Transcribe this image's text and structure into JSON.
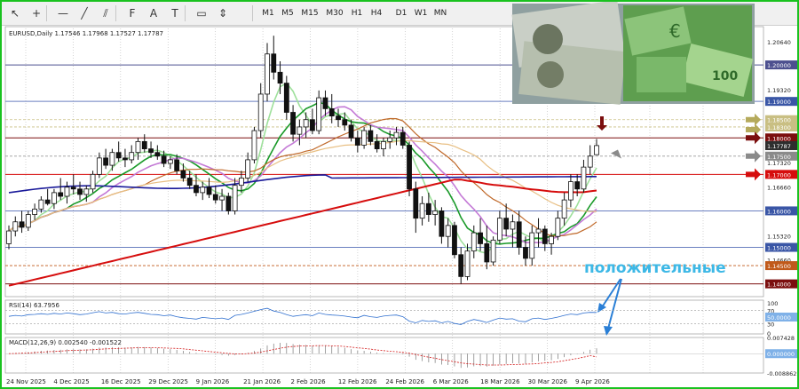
{
  "toolbar": {
    "tools": [
      {
        "name": "cursor-icon",
        "glyph": "↖"
      },
      {
        "name": "crosshair-icon",
        "glyph": "+"
      },
      {
        "name": "hline-icon",
        "glyph": "—"
      },
      {
        "name": "trendline-icon",
        "glyph": "╱"
      },
      {
        "name": "channel-icon",
        "glyph": "⫽"
      },
      {
        "name": "fibo-icon",
        "glyph": "F"
      },
      {
        "name": "text-icon",
        "glyph": "A"
      },
      {
        "name": "label-icon",
        "glyph": "T"
      },
      {
        "name": "shape-icon",
        "glyph": "▭"
      },
      {
        "name": "arrows-icon",
        "glyph": "⇕"
      }
    ],
    "timeframes": [
      "M1",
      "M5",
      "M15",
      "M30",
      "H1",
      "H4",
      "D1",
      "W1",
      "MN"
    ]
  },
  "chart_data": {
    "type": "candlestick",
    "header": "EURUSD,Daily  1.17546 1.17968 1.17527 1.17787",
    "annotation": "положительные",
    "ylim": [
      1.1365,
      1.21
    ],
    "price_ticks": [
      {
        "v": 1.2064,
        "t": "1.20640"
      },
      {
        "v": 1.1932,
        "t": "1.19320"
      },
      {
        "v": 1.1798,
        "t": "1.17980"
      },
      {
        "v": 1.1732,
        "t": "1.17320"
      },
      {
        "v": 1.1666,
        "t": "1.16660"
      },
      {
        "v": 1.1532,
        "t": "1.15320"
      },
      {
        "v": 1.1466,
        "t": "1.14660"
      }
    ],
    "price_tags": [
      {
        "v": 1.2,
        "t": "1.20000",
        "bg": "#4c4f8f"
      },
      {
        "v": 1.19,
        "t": "1.19000",
        "bg": "#3a56a6"
      },
      {
        "v": 1.185,
        "t": "1.18500",
        "bg": "#c9bf83"
      },
      {
        "v": 1.183,
        "t": "1.18300",
        "bg": "#c9bf83"
      },
      {
        "v": 1.18,
        "t": "1.18000",
        "bg": "#7b0e0e"
      },
      {
        "v": 1.17787,
        "t": "1.17787",
        "bg": "#2e2e2e"
      },
      {
        "v": 1.175,
        "t": "1.17500",
        "bg": "#8a8a8a"
      },
      {
        "v": 1.17,
        "t": "1.17000",
        "bg": "#d60d0d"
      },
      {
        "v": 1.16,
        "t": "1.16000",
        "bg": "#3a56a6"
      },
      {
        "v": 1.15,
        "t": "1.15000",
        "bg": "#3a56a6"
      },
      {
        "v": 1.145,
        "t": "1.14500",
        "bg": "#c0591a"
      },
      {
        "v": 1.14,
        "t": "1.14000",
        "bg": "#7b0e0e"
      }
    ],
    "levels": [
      {
        "v": 1.2,
        "color": "#4c4f8f",
        "dash": false
      },
      {
        "v": 1.19,
        "color": "#6a7fc0",
        "dash": false
      },
      {
        "v": 1.185,
        "color": "#c9bf83",
        "dash": true
      },
      {
        "v": 1.183,
        "color": "#c9bf83",
        "dash": true
      },
      {
        "v": 1.18,
        "color": "#7b0e0e",
        "dash": false
      },
      {
        "v": 1.175,
        "color": "#9a9a9a",
        "dash": true
      },
      {
        "v": 1.17,
        "color": "#d60d0d",
        "dash": false
      },
      {
        "v": 1.16,
        "color": "#6a7fc0",
        "dash": false
      },
      {
        "v": 1.15,
        "color": "#6a7fc0",
        "dash": false
      },
      {
        "v": 1.145,
        "color": "#c0591a",
        "dash": true
      },
      {
        "v": 1.14,
        "color": "#7b0e0e",
        "dash": false
      }
    ],
    "date_labels": [
      "24 Nov 2025",
      "4 Dec 2025",
      "16 Dec 2025",
      "29 Dec 2025",
      "9 Jan 2026",
      "21 Jan 2026",
      "2 Feb 2026",
      "12 Feb 2026",
      "24 Feb 2026",
      "6 Mar 2026",
      "18 Mar 2026",
      "30 Mar 2026",
      "9 Apr 2026"
    ],
    "candles": [
      [
        1.151,
        1.156,
        1.1495,
        1.1545
      ],
      [
        1.1545,
        1.1585,
        1.153,
        1.157
      ],
      [
        1.157,
        1.16,
        1.154,
        1.1555
      ],
      [
        1.1555,
        1.16,
        1.1545,
        1.159
      ],
      [
        1.159,
        1.162,
        1.1575,
        1.1605
      ],
      [
        1.1605,
        1.164,
        1.1595,
        1.163
      ],
      [
        1.163,
        1.166,
        1.1615,
        1.162
      ],
      [
        1.162,
        1.166,
        1.1605,
        1.165
      ],
      [
        1.165,
        1.169,
        1.163,
        1.164
      ],
      [
        1.164,
        1.168,
        1.162,
        1.1665
      ],
      [
        1.1665,
        1.17,
        1.1645,
        1.166
      ],
      [
        1.166,
        1.168,
        1.163,
        1.1645
      ],
      [
        1.1645,
        1.167,
        1.1625,
        1.166
      ],
      [
        1.166,
        1.171,
        1.165,
        1.17
      ],
      [
        1.17,
        1.176,
        1.169,
        1.1745
      ],
      [
        1.1745,
        1.177,
        1.1715,
        1.1725
      ],
      [
        1.1725,
        1.177,
        1.171,
        1.176
      ],
      [
        1.176,
        1.179,
        1.1735,
        1.1745
      ],
      [
        1.1745,
        1.177,
        1.172,
        1.174
      ],
      [
        1.174,
        1.178,
        1.173,
        1.176
      ],
      [
        1.176,
        1.18,
        1.174,
        1.179
      ],
      [
        1.179,
        1.181,
        1.176,
        1.177
      ],
      [
        1.177,
        1.179,
        1.1745,
        1.176
      ],
      [
        1.176,
        1.178,
        1.174,
        1.175
      ],
      [
        1.175,
        1.1765,
        1.172,
        1.173
      ],
      [
        1.173,
        1.175,
        1.1715,
        1.174
      ],
      [
        1.174,
        1.1755,
        1.17,
        1.171
      ],
      [
        1.171,
        1.173,
        1.168,
        1.169
      ],
      [
        1.169,
        1.171,
        1.166,
        1.167
      ],
      [
        1.167,
        1.17,
        1.164,
        1.165
      ],
      [
        1.165,
        1.168,
        1.163,
        1.1665
      ],
      [
        1.1665,
        1.169,
        1.1635,
        1.1645
      ],
      [
        1.1645,
        1.167,
        1.162,
        1.163
      ],
      [
        1.163,
        1.166,
        1.16,
        1.164
      ],
      [
        1.164,
        1.165,
        1.159,
        1.16
      ],
      [
        1.16,
        1.169,
        1.159,
        1.167
      ],
      [
        1.167,
        1.171,
        1.165,
        1.169
      ],
      [
        1.169,
        1.176,
        1.168,
        1.174
      ],
      [
        1.174,
        1.183,
        1.173,
        1.182
      ],
      [
        1.182,
        1.195,
        1.18,
        1.192
      ],
      [
        1.192,
        1.206,
        1.19,
        1.203
      ],
      [
        1.203,
        1.208,
        1.196,
        1.198
      ],
      [
        1.198,
        1.201,
        1.192,
        1.195
      ],
      [
        1.195,
        1.197,
        1.185,
        1.187
      ],
      [
        1.187,
        1.189,
        1.179,
        1.181
      ],
      [
        1.181,
        1.185,
        1.178,
        1.183
      ],
      [
        1.183,
        1.187,
        1.18,
        1.185
      ],
      [
        1.185,
        1.188,
        1.181,
        1.182
      ],
      [
        1.182,
        1.193,
        1.181,
        1.191
      ],
      [
        1.191,
        1.193,
        1.186,
        1.188
      ],
      [
        1.188,
        1.192,
        1.184,
        1.186
      ],
      [
        1.186,
        1.188,
        1.183,
        1.185
      ],
      [
        1.185,
        1.187,
        1.182,
        1.1835
      ],
      [
        1.1835,
        1.185,
        1.179,
        1.18
      ],
      [
        1.18,
        1.182,
        1.176,
        1.178
      ],
      [
        1.178,
        1.183,
        1.177,
        1.182
      ],
      [
        1.182,
        1.1835,
        1.178,
        1.179
      ],
      [
        1.179,
        1.181,
        1.176,
        1.177
      ],
      [
        1.177,
        1.18,
        1.175,
        1.179
      ],
      [
        1.179,
        1.182,
        1.177,
        1.18
      ],
      [
        1.18,
        1.183,
        1.178,
        1.1815
      ],
      [
        1.1815,
        1.183,
        1.177,
        1.178
      ],
      [
        1.178,
        1.179,
        1.164,
        1.166
      ],
      [
        1.166,
        1.168,
        1.154,
        1.158
      ],
      [
        1.158,
        1.164,
        1.156,
        1.162
      ],
      [
        1.162,
        1.165,
        1.157,
        1.159
      ],
      [
        1.159,
        1.163,
        1.156,
        1.16
      ],
      [
        1.16,
        1.161,
        1.151,
        1.153
      ],
      [
        1.153,
        1.158,
        1.15,
        1.156
      ],
      [
        1.156,
        1.157,
        1.147,
        1.148
      ],
      [
        1.148,
        1.15,
        1.14,
        1.142
      ],
      [
        1.142,
        1.151,
        1.141,
        1.149
      ],
      [
        1.149,
        1.156,
        1.147,
        1.154
      ],
      [
        1.154,
        1.158,
        1.149,
        1.151
      ],
      [
        1.151,
        1.156,
        1.144,
        1.146
      ],
      [
        1.146,
        1.153,
        1.145,
        1.152
      ],
      [
        1.152,
        1.16,
        1.151,
        1.158
      ],
      [
        1.158,
        1.162,
        1.153,
        1.155
      ],
      [
        1.155,
        1.159,
        1.15,
        1.157
      ],
      [
        1.157,
        1.16,
        1.148,
        1.15
      ],
      [
        1.15,
        1.153,
        1.145,
        1.147
      ],
      [
        1.147,
        1.156,
        1.145,
        1.154
      ],
      [
        1.154,
        1.158,
        1.15,
        1.155
      ],
      [
        1.155,
        1.156,
        1.149,
        1.151
      ],
      [
        1.151,
        1.154,
        1.148,
        1.153
      ],
      [
        1.153,
        1.16,
        1.152,
        1.158
      ],
      [
        1.158,
        1.165,
        1.156,
        1.163
      ],
      [
        1.163,
        1.17,
        1.161,
        1.168
      ],
      [
        1.168,
        1.17,
        1.164,
        1.166
      ],
      [
        1.166,
        1.174,
        1.165,
        1.172
      ],
      [
        1.172,
        1.178,
        1.17,
        1.175
      ],
      [
        1.1754,
        1.1797,
        1.1753,
        1.1779
      ]
    ],
    "rsi": {
      "label": "RSI(14) 63.7956",
      "ylim": [
        0,
        100
      ],
      "ticks": [
        "100",
        "70",
        "30",
        "0"
      ],
      "tag": "50.0000",
      "values": [
        52,
        55,
        53,
        57,
        58,
        60,
        58,
        61,
        59,
        62,
        60,
        57,
        59,
        63,
        66,
        62,
        64,
        60,
        59,
        62,
        64,
        61,
        58,
        57,
        54,
        56,
        51,
        48,
        46,
        44,
        49,
        47,
        45,
        47,
        43,
        55,
        58,
        62,
        67,
        72,
        76,
        68,
        64,
        57,
        52,
        55,
        57,
        54,
        62,
        58,
        56,
        55,
        53,
        50,
        48,
        55,
        51,
        49,
        53,
        55,
        56,
        51,
        38,
        33,
        40,
        37,
        39,
        33,
        37,
        31,
        28,
        37,
        43,
        39,
        34,
        41,
        47,
        44,
        45,
        38,
        36,
        45,
        47,
        43,
        46,
        50,
        55,
        59,
        57,
        62,
        64,
        63.8
      ]
    },
    "macd": {
      "label": "MACD(12,26,9) 0.002540 -0.001522",
      "ylim": [
        -0.00886,
        0.00742
      ],
      "ticks": [
        {
          "v": 0.00742,
          "t": "0.007428"
        },
        {
          "v": -0.00886,
          "t": "-0.008862"
        }
      ],
      "tag": "0.000000",
      "hist": [
        0.0,
        0.0003,
        0.0004,
        0.0007,
        0.001,
        0.0013,
        0.0014,
        0.0017,
        0.0018,
        0.002,
        0.0021,
        0.002,
        0.002,
        0.0023,
        0.0028,
        0.0028,
        0.003,
        0.0029,
        0.0028,
        0.0029,
        0.0031,
        0.003,
        0.0028,
        0.0026,
        0.0023,
        0.0021,
        0.0017,
        0.0013,
        0.0008,
        0.0004,
        0.0002,
        -0.0001,
        -0.0004,
        -0.0006,
        -0.0009,
        -0.0006,
        -0.0002,
        0.0004,
        0.0013,
        0.0024,
        0.0038,
        0.0046,
        0.005,
        0.0049,
        0.0044,
        0.0041,
        0.004,
        0.0036,
        0.0038,
        0.0037,
        0.0034,
        0.0031,
        0.0027,
        0.0021,
        0.0015,
        0.0013,
        0.0009,
        0.0005,
        0.0003,
        0.0002,
        0.0001,
        -0.0003,
        -0.0014,
        -0.0028,
        -0.0034,
        -0.004,
        -0.0043,
        -0.005,
        -0.0052,
        -0.0058,
        -0.0065,
        -0.0063,
        -0.0058,
        -0.0057,
        -0.0059,
        -0.0055,
        -0.0049,
        -0.0047,
        -0.0044,
        -0.0045,
        -0.0046,
        -0.004,
        -0.0035,
        -0.0033,
        -0.003,
        -0.0024,
        -0.0016,
        -0.0007,
        -0.0002,
        0.0008,
        0.0018,
        0.0025
      ],
      "signal": [
        0.0,
        0.0001,
        0.0002,
        0.0003,
        0.0005,
        0.0007,
        0.0009,
        0.001,
        0.0012,
        0.0014,
        0.0015,
        0.0016,
        0.0017,
        0.0018,
        0.002,
        0.0022,
        0.0023,
        0.0024,
        0.0025,
        0.0026,
        0.0027,
        0.0027,
        0.0027,
        0.0027,
        0.0026,
        0.0025,
        0.0024,
        0.0022,
        0.0019,
        0.0016,
        0.0013,
        0.001,
        0.0007,
        0.0004,
        0.0001,
        -0.0001,
        -0.0001,
        0.0,
        0.0003,
        0.0007,
        0.0013,
        0.0019,
        0.0025,
        0.003,
        0.0033,
        0.0035,
        0.0036,
        0.0036,
        0.0037,
        0.0037,
        0.0036,
        0.0035,
        0.0033,
        0.003,
        0.0027,
        0.0024,
        0.0021,
        0.0017,
        0.0014,
        0.0011,
        0.0009,
        0.0006,
        0.0002,
        -0.0004,
        -0.001,
        -0.0016,
        -0.0021,
        -0.0027,
        -0.0032,
        -0.0037,
        -0.0042,
        -0.0046,
        -0.0048,
        -0.005,
        -0.0052,
        -0.0052,
        -0.0052,
        -0.0051,
        -0.005,
        -0.0049,
        -0.0048,
        -0.0047,
        -0.0045,
        -0.0042,
        -0.004,
        -0.0037,
        -0.0032,
        -0.0027,
        -0.0022,
        -0.0016,
        -0.0009,
        -0.0015
      ]
    }
  },
  "colors": {
    "frame": "#19c21f",
    "annotation": "#3db8e6",
    "bull_arrow": "#7b0e0e",
    "gray_arrow": "#8a8a8a",
    "olive_arrow": "#b5aa5c"
  }
}
